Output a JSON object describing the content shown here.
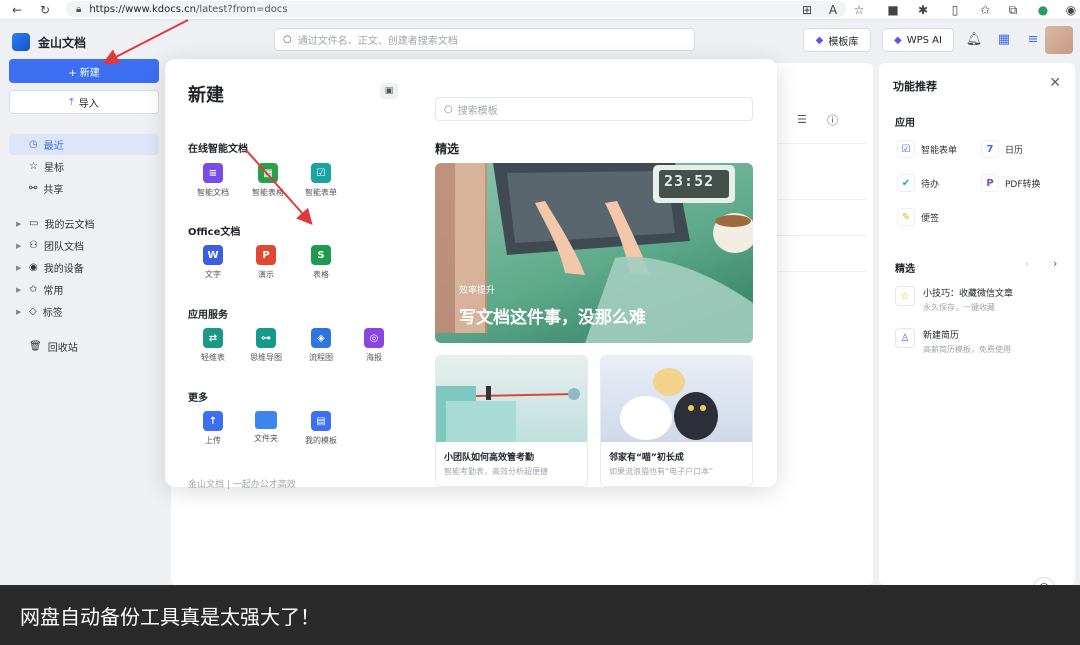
{
  "browser": {
    "url_host": "https://www.kdocs.cn",
    "url_path": "/latest?from=docs"
  },
  "header": {
    "app_name": "金山文档",
    "search_placeholder": "通过文件名、正文、创建者搜索文档",
    "template_btn": "模板库",
    "wps_ai_btn": "WPS AI"
  },
  "sidebar": {
    "new_btn": "+ 新建",
    "import_btn": "导入",
    "items": [
      {
        "label": "最近",
        "icon": "clock-icon"
      },
      {
        "label": "星标",
        "icon": "star-icon"
      },
      {
        "label": "共享",
        "icon": "share-icon"
      },
      {
        "label": "我的云文档",
        "icon": "folder-icon"
      },
      {
        "label": "团队文档",
        "icon": "team-icon"
      },
      {
        "label": "我的设备",
        "icon": "device-icon"
      },
      {
        "label": "常用",
        "icon": "pin-icon"
      },
      {
        "label": "标签",
        "icon": "tag-icon"
      },
      {
        "label": "回收站",
        "icon": "trash-icon"
      }
    ]
  },
  "popup": {
    "title": "新建",
    "online_section": "在线智能文档",
    "online": [
      "智能文档",
      "智能表格",
      "智能表单"
    ],
    "office_section": "Office文档",
    "office": [
      "文字",
      "演示",
      "表格"
    ],
    "apps_section": "应用服务",
    "apps": [
      "轻维表",
      "思维导图",
      "流程图",
      "海报"
    ],
    "more_section": "更多",
    "more": [
      "上传",
      "文件夹",
      "我的模板"
    ],
    "footer": "金山文档 | 一起办公才高效",
    "template_search": "搜索模板",
    "featured": "精选",
    "hero_tag": "效率提升",
    "hero_title": "写文档这件事，没那么难",
    "hero_clock": "23:52",
    "card1_title": "小团队如何高效管考勤",
    "card1_sub": "智能考勤表，高效分析超便捷",
    "card2_title": "邻家有“喵”初长成",
    "card2_sub": "如果流浪猫也有“电子户口本”"
  },
  "right_panel": {
    "title": "功能推荐",
    "apps_title": "应用",
    "apps": [
      "智能表单",
      "日历",
      "待办",
      "PDF转换",
      "便签"
    ],
    "featured_title": "精选",
    "rec": [
      {
        "title": "小技巧：收藏微信文章",
        "sub": "永久保存，一键收藏"
      },
      {
        "title": "新建简历",
        "sub": "高薪简历模板，免费使用"
      }
    ]
  },
  "caption": "网盘自动备份工具真是太强大了！",
  "colors": {
    "accent": "#3d6ff2",
    "arrow": "#e03a3a"
  }
}
